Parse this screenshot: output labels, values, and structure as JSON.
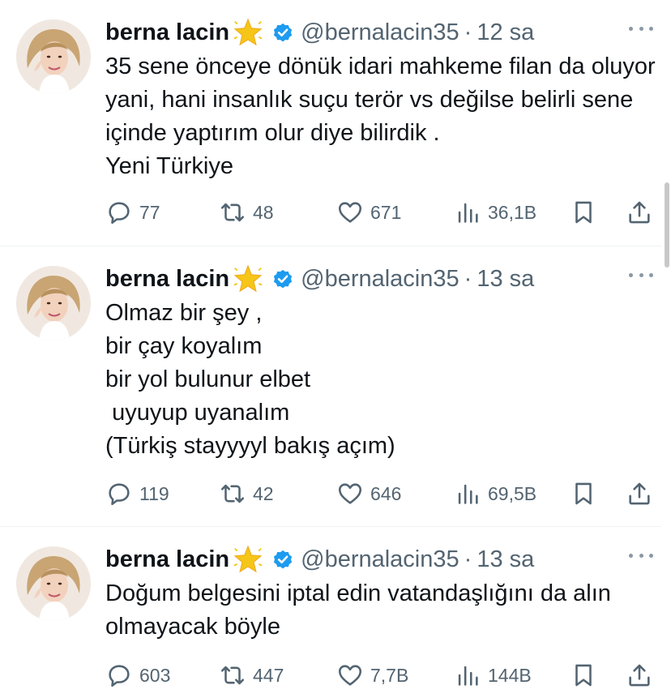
{
  "colors": {
    "text": "#0f1419",
    "secondary": "#536471",
    "verified": "#1d9bf0",
    "star": "#f5c518",
    "divider": "#eff3f4"
  },
  "tweets": [
    {
      "name": "berna lacin",
      "handle": "@bernalacin35",
      "separator": "·",
      "time": "12 sa",
      "text": "35 sene önceye dönük idari mahkeme filan da oluyor yani, hani insanlık suçu terör vs değilse belirli sene içinde yaptırım olur diye bilirdik .\nYeni Türkiye",
      "replies": "77",
      "reposts": "48",
      "likes": "671",
      "views": "36,1B"
    },
    {
      "name": "berna lacin",
      "handle": "@bernalacin35",
      "separator": "·",
      "time": "13 sa",
      "text": "Olmaz bir şey ,\nbir çay koyalım\nbir yol bulunur elbet\n uyuyup uyanalım\n(Türkiş stayyyyl bakış açım)",
      "replies": "119",
      "reposts": "42",
      "likes": "646",
      "views": "69,5B"
    },
    {
      "name": "berna lacin",
      "handle": "@bernalacin35",
      "separator": "·",
      "time": "13 sa",
      "text": "Doğum belgesini iptal edin vatandaşlığını da alın olmayacak böyle",
      "replies": "603",
      "reposts": "447",
      "likes": "7,7B",
      "views": "144B"
    }
  ]
}
